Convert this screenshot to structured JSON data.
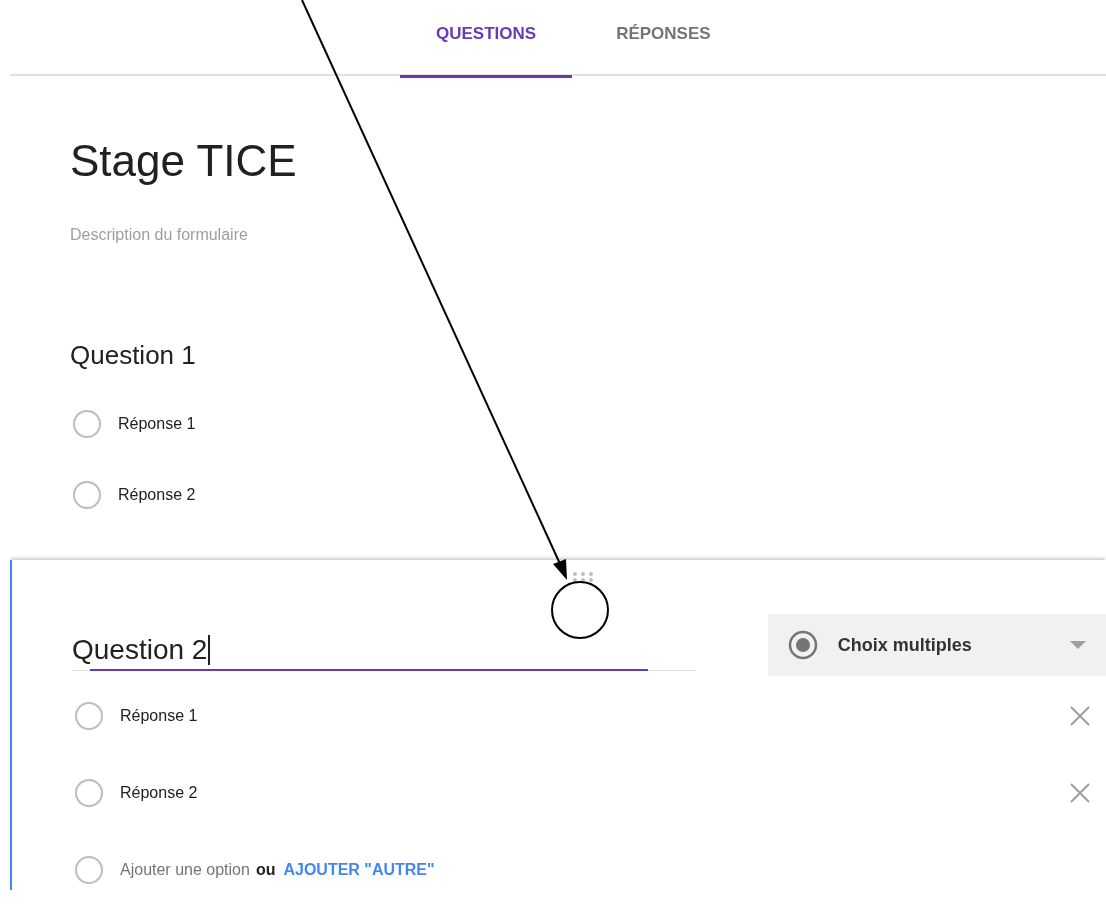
{
  "tabs": [
    {
      "label": "QUESTIONS",
      "selected": true
    },
    {
      "label": "RÉPONSES",
      "selected": false
    }
  ],
  "form": {
    "title": "Stage TICE",
    "description": "Description du formulaire"
  },
  "questions": [
    {
      "title": "Question 1",
      "editing": false,
      "options": [
        {
          "label": "Réponse 1"
        },
        {
          "label": "Réponse 2"
        }
      ]
    },
    {
      "title": "Question 2",
      "editing": true,
      "type": "Choix multiples",
      "options": [
        {
          "label": "Réponse 1"
        },
        {
          "label": "Réponse 2"
        }
      ],
      "add_option": {
        "placeholder": "Ajouter une option",
        "separator": "ou",
        "link": "AJOUTER \"AUTRE\""
      }
    }
  ]
}
